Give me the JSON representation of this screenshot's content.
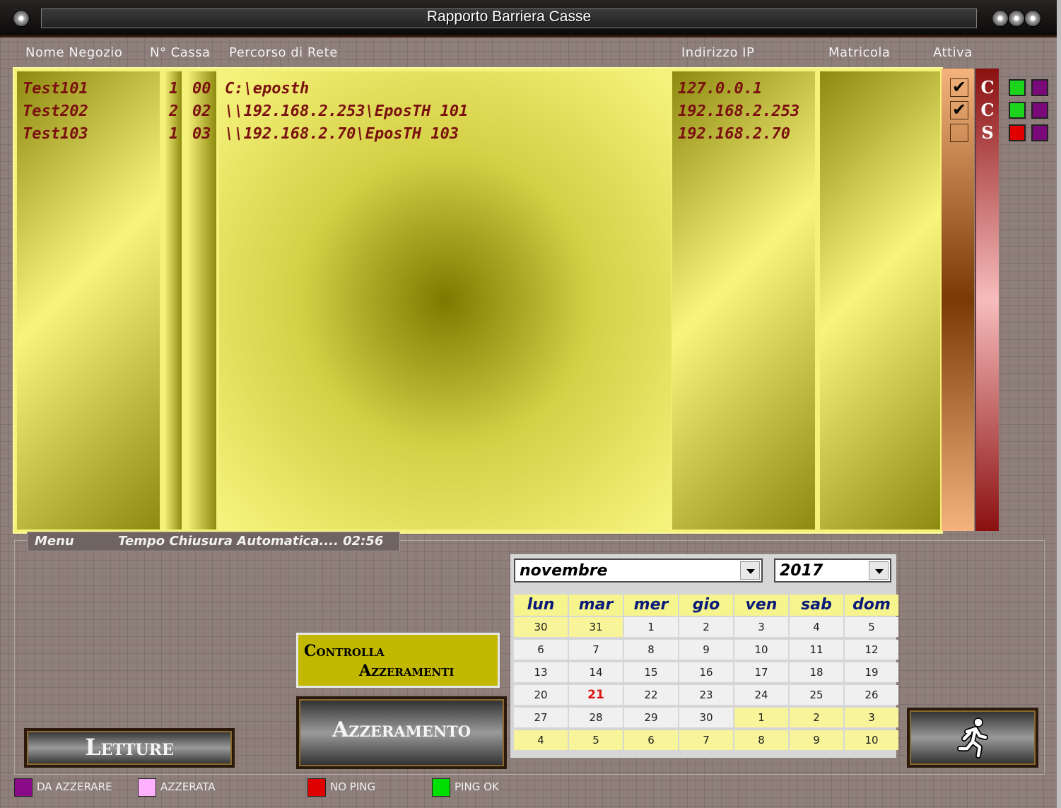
{
  "window": {
    "title": "Rapporto Barriera Casse"
  },
  "columns": {
    "nome": "Nome Negozio",
    "cassa": "N° Cassa",
    "percorso": "Percorso di Rete",
    "ip": "Indirizzo IP",
    "matricola": "Matricola",
    "attiva": "Attiva"
  },
  "rows": [
    {
      "nome": "Test101",
      "n": "1",
      "cassa": "00",
      "percorso": "C:\\eposth",
      "ip": "127.0.0.1",
      "attiva": true,
      "ccs": "C",
      "ping": "ok"
    },
    {
      "nome": "Test202",
      "n": "2",
      "cassa": "02",
      "percorso": "\\\\192.168.2.253\\EposTH 101",
      "ip": "192.168.2.253",
      "attiva": true,
      "ccs": "C",
      "ping": "ok"
    },
    {
      "nome": "Test103",
      "n": "1",
      "cassa": "03",
      "percorso": "\\\\192.168.2.70\\EposTH 103",
      "ip": "192.168.2.70",
      "attiva": false,
      "ccs": "S",
      "ping": "no"
    }
  ],
  "menubar": {
    "menu": "Menu",
    "timer": "Tempo Chiusura Automatica.... 02:56"
  },
  "calendar": {
    "month": "novembre",
    "year": "2017",
    "weekdays": [
      "lun",
      "mar",
      "mer",
      "gio",
      "ven",
      "sab",
      "dom"
    ],
    "weeks": [
      [
        "30",
        "31",
        "1",
        "2",
        "3",
        "4",
        "5"
      ],
      [
        "6",
        "7",
        "8",
        "9",
        "10",
        "11",
        "12"
      ],
      [
        "13",
        "14",
        "15",
        "16",
        "17",
        "18",
        "19"
      ],
      [
        "20",
        "21",
        "22",
        "23",
        "24",
        "25",
        "26"
      ],
      [
        "27",
        "28",
        "29",
        "30",
        "1",
        "2",
        "3"
      ],
      [
        "4",
        "5",
        "6",
        "7",
        "8",
        "9",
        "10"
      ]
    ],
    "today": "21"
  },
  "buttons": {
    "controlla_line1": "Controlla",
    "controlla_line2": "Azzeramenti",
    "azzeramento": "Azzeramento",
    "letture": "Letture"
  },
  "legend": [
    {
      "label": "DA AZZERARE",
      "color": "#8a0a8a"
    },
    {
      "label": "AZZERATA",
      "color": "#ffb0ff"
    },
    {
      "label": "NO PING",
      "color": "#e00000"
    },
    {
      "label": "PING OK",
      "color": "#00e000"
    }
  ],
  "colors": {
    "ping_ok": "#1bd41b",
    "ping_no": "#e00000",
    "status": "#7a0a7a"
  }
}
